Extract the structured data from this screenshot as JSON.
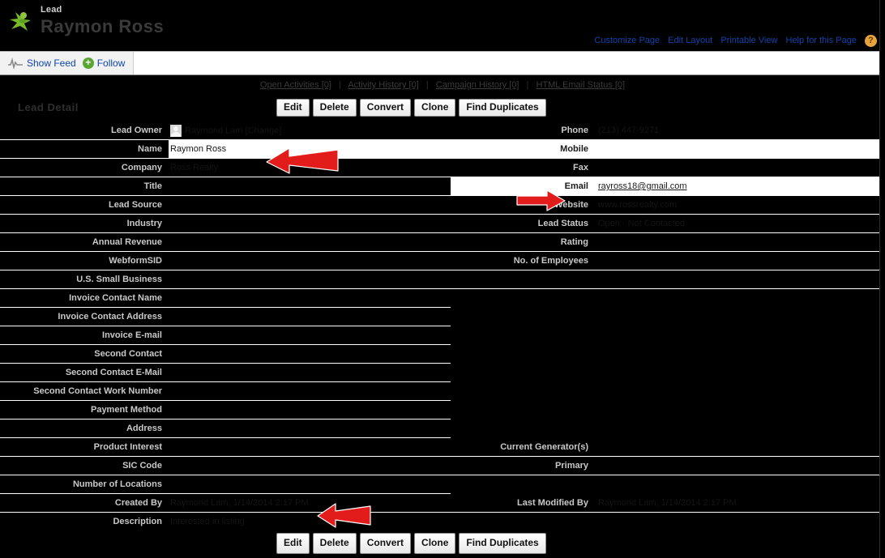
{
  "header": {
    "record_type": "Lead",
    "record_name": "Raymon Ross",
    "icon": "lead-star-person-icon",
    "links": [
      {
        "label": "Customize Page"
      },
      {
        "label": "Edit Layout"
      },
      {
        "label": "Printable View"
      },
      {
        "label": "Help for this Page"
      }
    ],
    "help_icon": "?"
  },
  "feed_bar": {
    "show_feed": "Show Feed",
    "follow": "Follow",
    "follow_icon": "+",
    "pulse_icon": "feed-pulse-icon"
  },
  "related_links": [
    {
      "label": "Open Activities",
      "count": "[0]"
    },
    {
      "label": "Activity History",
      "count": "[0]"
    },
    {
      "label": "Campaign History",
      "count": "[0]"
    },
    {
      "label": "HTML Email Status",
      "count": "[0]"
    }
  ],
  "detail": {
    "section_title": "Lead Detail",
    "buttons": [
      {
        "label": "Edit"
      },
      {
        "label": "Delete"
      },
      {
        "label": "Convert"
      },
      {
        "label": "Clone"
      },
      {
        "label": "Find Duplicates"
      }
    ]
  },
  "fields": {
    "lead_owner": {
      "label": "Lead Owner",
      "value": "Raymond Lam [Change]"
    },
    "phone": {
      "label": "Phone",
      "value": "(213) 447-9271"
    },
    "name": {
      "label": "Name",
      "value": "Raymon Ross"
    },
    "mobile": {
      "label": "Mobile",
      "value": ""
    },
    "company": {
      "label": "Company",
      "value": "Ross Realty"
    },
    "fax": {
      "label": "Fax",
      "value": ""
    },
    "title": {
      "label": "Title",
      "value": ""
    },
    "email": {
      "label": "Email",
      "value": "rayross18@gmail.com"
    },
    "lead_source": {
      "label": "Lead Source",
      "value": ""
    },
    "website": {
      "label": "Website",
      "value": "www.rossrealty.com"
    },
    "industry": {
      "label": "Industry",
      "value": ""
    },
    "lead_status": {
      "label": "Lead Status",
      "value": "Open - Not Contacted"
    },
    "annual_revenue": {
      "label": "Annual Revenue",
      "value": ""
    },
    "rating": {
      "label": "Rating",
      "value": ""
    },
    "webform_sid": {
      "label": "WebformSID",
      "value": ""
    },
    "no_of_employees": {
      "label": "No. of Employees",
      "value": ""
    },
    "us_small_business": {
      "label": "U.S. Small Business",
      "value": ""
    },
    "invoice_contact_name": {
      "label": "Invoice Contact Name",
      "value": ""
    },
    "invoice_contact_address": {
      "label": "Invoice Contact Address",
      "value": ""
    },
    "invoice_email": {
      "label": "Invoice E-mail",
      "value": ""
    },
    "second_contact": {
      "label": "Second Contact",
      "value": ""
    },
    "second_contact_email": {
      "label": "Second Contact E-Mail",
      "value": ""
    },
    "second_contact_work_number": {
      "label": "Second Contact Work Number",
      "value": ""
    },
    "payment_method": {
      "label": "Payment Method",
      "value": ""
    },
    "address": {
      "label": "Address",
      "value": ""
    },
    "product_interest": {
      "label": "Product Interest",
      "value": ""
    },
    "current_generators": {
      "label": "Current Generator(s)",
      "value": ""
    },
    "sic_code": {
      "label": "SIC Code",
      "value": ""
    },
    "primary": {
      "label": "Primary",
      "value": ""
    },
    "number_of_locations": {
      "label": "Number of Locations",
      "value": ""
    },
    "created_by": {
      "label": "Created By",
      "value": "Raymond Lam, 1/14/2014 2:17 PM"
    },
    "last_modified_by": {
      "label": "Last Modified By",
      "value": "Raymond Lam, 1/14/2014 2:17 PM"
    },
    "description": {
      "label": "Description",
      "value": "Interested in listing"
    }
  },
  "colors": {
    "background": "#000000",
    "link": "#1144aa",
    "accent_green": "#5aa632",
    "arrow_red": "#e21b1b",
    "help_orange": "#e8a33d"
  },
  "annotations": [
    {
      "name": "arrow-name-field",
      "direction": "left"
    },
    {
      "name": "arrow-email-field",
      "direction": "right"
    },
    {
      "name": "arrow-description-field",
      "direction": "left"
    }
  ]
}
